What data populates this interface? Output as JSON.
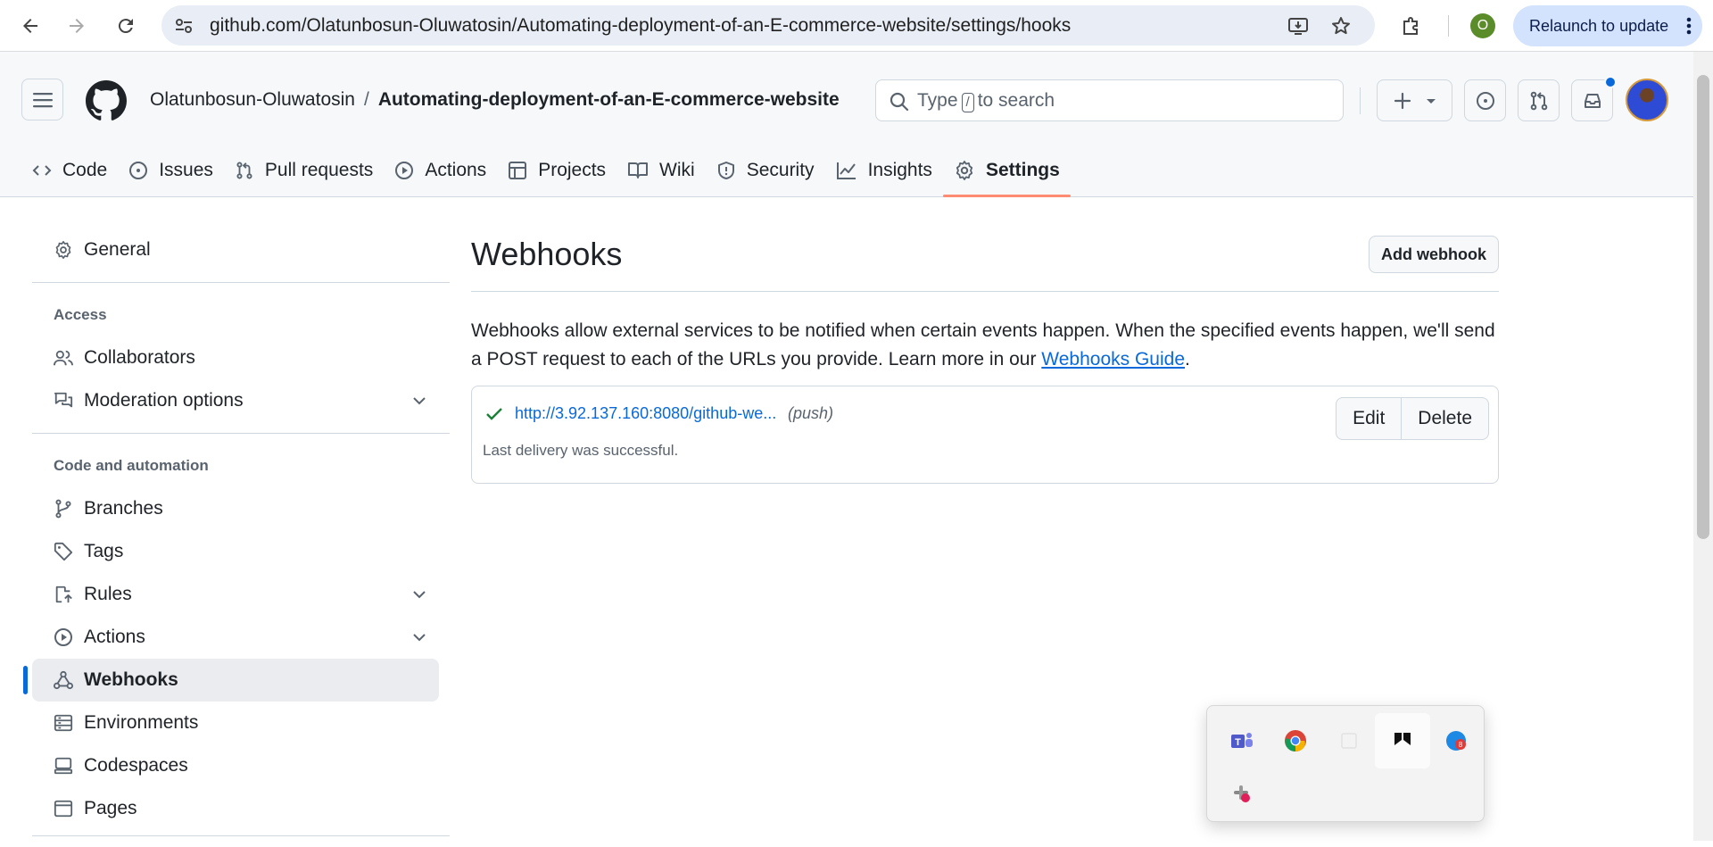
{
  "browser": {
    "url": "github.com/Olatunbosun-Oluwatosin/Automating-deployment-of-an-E-commerce-website/settings/hooks",
    "profile_initial": "O",
    "relaunch_label": "Relaunch to update"
  },
  "header": {
    "owner": "Olatunbosun-Oluwatosin",
    "separator": "/",
    "repo": "Automating-deployment-of-an-E-commerce-website",
    "search_prefix": "Type",
    "search_key": "/",
    "search_suffix": "to search"
  },
  "tabs": [
    {
      "label": "Code"
    },
    {
      "label": "Issues"
    },
    {
      "label": "Pull requests"
    },
    {
      "label": "Actions"
    },
    {
      "label": "Projects"
    },
    {
      "label": "Wiki"
    },
    {
      "label": "Security"
    },
    {
      "label": "Insights"
    },
    {
      "label": "Settings"
    }
  ],
  "sidebar": {
    "general": "General",
    "access_heading": "Access",
    "collaborators": "Collaborators",
    "moderation": "Moderation options",
    "code_heading": "Code and automation",
    "branches": "Branches",
    "tags": "Tags",
    "rules": "Rules",
    "actions": "Actions",
    "webhooks": "Webhooks",
    "environments": "Environments",
    "codespaces": "Codespaces",
    "pages": "Pages"
  },
  "main": {
    "title": "Webhooks",
    "add_button": "Add webhook",
    "description": "Webhooks allow external services to be notified when certain events happen. When the specified events happen, we'll send a POST request to each of the URLs you provide. Learn more in our ",
    "guide_link": "Webhooks Guide",
    "period": ".",
    "hook": {
      "url": "http://3.92.137.160:8080/github-we...",
      "events": "(push)",
      "status": "Last delivery was successful.",
      "edit_label": "Edit",
      "delete_label": "Delete"
    }
  },
  "colors": {
    "accent": "#0969da",
    "tab_underline": "#fd8c73",
    "success": "#1a7f37"
  }
}
